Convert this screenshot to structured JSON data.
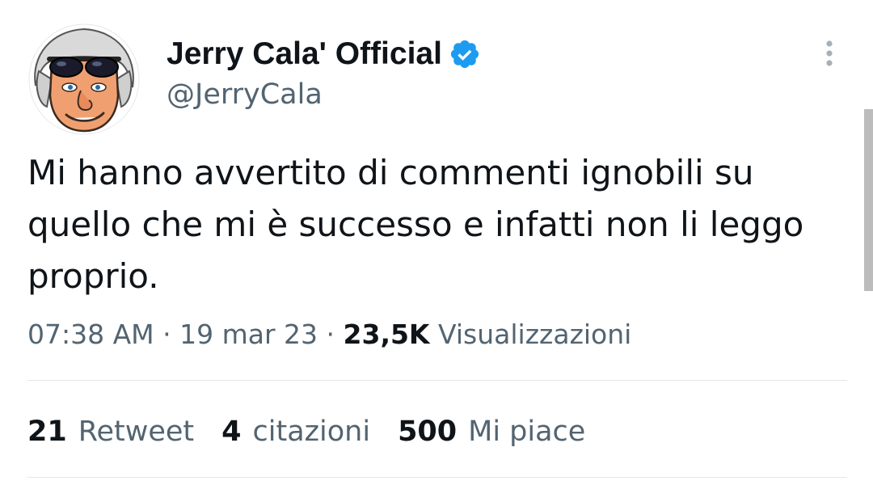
{
  "author": {
    "display_name": "Jerry Cala' Official",
    "handle": "@JerryCala",
    "verified": true
  },
  "tweet": {
    "text": "Mi hanno avvertito di commenti ignobili su quello che mi è successo e infatti non li leggo proprio.",
    "time": "07:38 AM",
    "date": "19 mar 23",
    "views_count": "23,5K",
    "views_label": "Visualizzazioni"
  },
  "stats": {
    "retweets": {
      "count": "21",
      "label": "Retweet"
    },
    "quotes": {
      "count": "4",
      "label": "citazioni"
    },
    "likes": {
      "count": "500",
      "label": "Mi piace"
    }
  },
  "colors": {
    "primary_text": "#0f1419",
    "secondary_text": "#536471",
    "verified_blue": "#1d9bf0",
    "divider": "#e1e6ea"
  },
  "icons": {
    "verified": "verified-badge-icon",
    "more": "more-vertical-icon"
  }
}
